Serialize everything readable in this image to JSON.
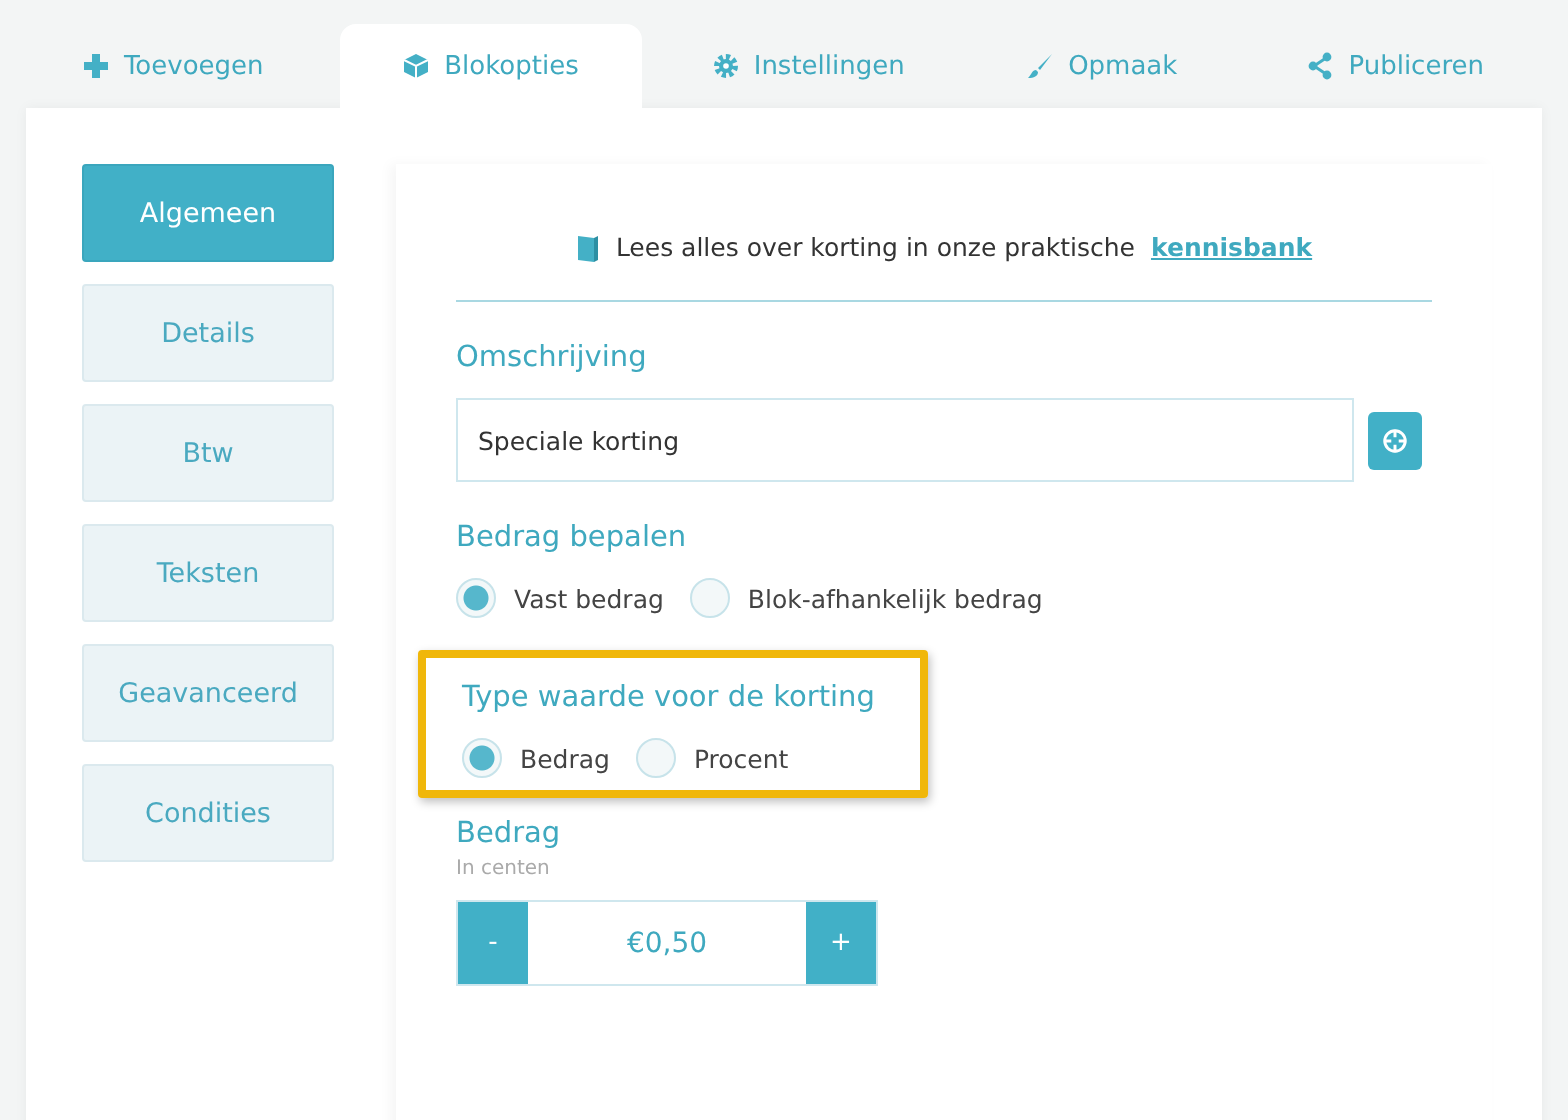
{
  "tabs": [
    {
      "label": "Toevoegen",
      "selected": false
    },
    {
      "label": "Blokopties",
      "selected": true
    },
    {
      "label": "Instellingen",
      "selected": false
    },
    {
      "label": "Opmaak",
      "selected": false
    },
    {
      "label": "Publiceren",
      "selected": false
    }
  ],
  "sidebar": {
    "items": [
      {
        "label": "Algemeen",
        "selected": true
      },
      {
        "label": "Details",
        "selected": false
      },
      {
        "label": "Btw",
        "selected": false
      },
      {
        "label": "Teksten",
        "selected": false
      },
      {
        "label": "Geavanceerd",
        "selected": false
      },
      {
        "label": "Condities",
        "selected": false
      }
    ]
  },
  "info": {
    "text": "Lees alles over korting in onze praktische",
    "link": "kennisbank"
  },
  "sections": [
    {
      "kind": "text",
      "title": "Omschrijving",
      "value": "Speciale korting",
      "highlighted": false
    },
    {
      "kind": "radio",
      "title": "Bedrag bepalen",
      "highlighted": false,
      "options": [
        {
          "label": "Vast bedrag",
          "selected": true
        },
        {
          "label": "Blok-afhankelijk bedrag",
          "selected": false
        }
      ]
    },
    {
      "kind": "radio",
      "title": "Type waarde voor de korting",
      "highlighted": true,
      "options": [
        {
          "label": "Bedrag",
          "selected": true
        },
        {
          "label": "Procent",
          "selected": false
        }
      ]
    },
    {
      "kind": "stepper",
      "title": "Bedrag",
      "hint": "In centen",
      "value": "€0,50",
      "minus": "-",
      "plus": "+",
      "highlighted": false
    }
  ]
}
